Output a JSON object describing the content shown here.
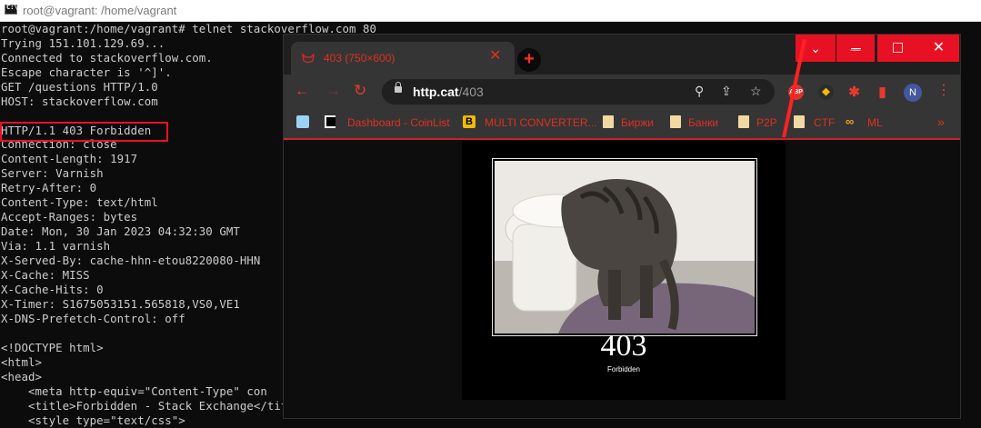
{
  "terminal": {
    "title": "root@vagrant: /home/vagrant",
    "lines": [
      "root@vagrant:/home/vagrant# telnet stackoverflow.com 80",
      "Trying 151.101.129.69...",
      "Connected to stackoverflow.com.",
      "Escape character is '^]'.",
      "GET /questions HTTP/1.0",
      "HOST: stackoverflow.com",
      "",
      "HTTP/1.1 403 Forbidden",
      "Connection: close",
      "Content-Length: 1917",
      "Server: Varnish",
      "Retry-After: 0",
      "Content-Type: text/html",
      "Accept-Ranges: bytes",
      "Date: Mon, 30 Jan 2023 04:32:30 GMT",
      "Via: 1.1 varnish",
      "X-Served-By: cache-hhn-etou8220080-HHN",
      "X-Cache: MISS",
      "X-Cache-Hits: 0",
      "X-Timer: S1675053151.565818,VS0,VE1",
      "X-DNS-Prefetch-Control: off",
      "",
      "<!DOCTYPE html>",
      "<html>",
      "<head>",
      "    <meta http-equiv=\"Content-Type\" con",
      "    <title>Forbidden - Stack Exchange</title>",
      "    <style type=\"text/css\">"
    ],
    "highlight_color": "#e81123"
  },
  "browser": {
    "tab_title": "403 (750×600)",
    "address": {
      "host": "http.cat",
      "path": "/403"
    },
    "window_controls": {
      "dropdown": "⌄",
      "minimize": "—",
      "maximize": "☐",
      "close": "✕"
    },
    "extensions": [
      {
        "name": "adblock-plus-icon",
        "label": "ABP",
        "color": "#e0322c"
      },
      {
        "name": "binance-extension-icon",
        "label": "◆",
        "color": "#2b2b2b"
      },
      {
        "name": "puzzle-extensions-icon",
        "label": "✱",
        "color": "#e83a2e"
      },
      {
        "name": "side-panel-icon",
        "label": "▮",
        "color": "#e83a2e"
      }
    ],
    "avatar_letter": "N",
    "bookmarks": [
      "Dashboard - CoinList",
      "MULTI CONVERTER...",
      "Биржи",
      "Банки",
      "P2P",
      "CTF",
      "ML"
    ],
    "bookmarks_more": "»",
    "page": {
      "code": "403",
      "caption": "Forbidden"
    },
    "accent": "#e83a2e"
  }
}
